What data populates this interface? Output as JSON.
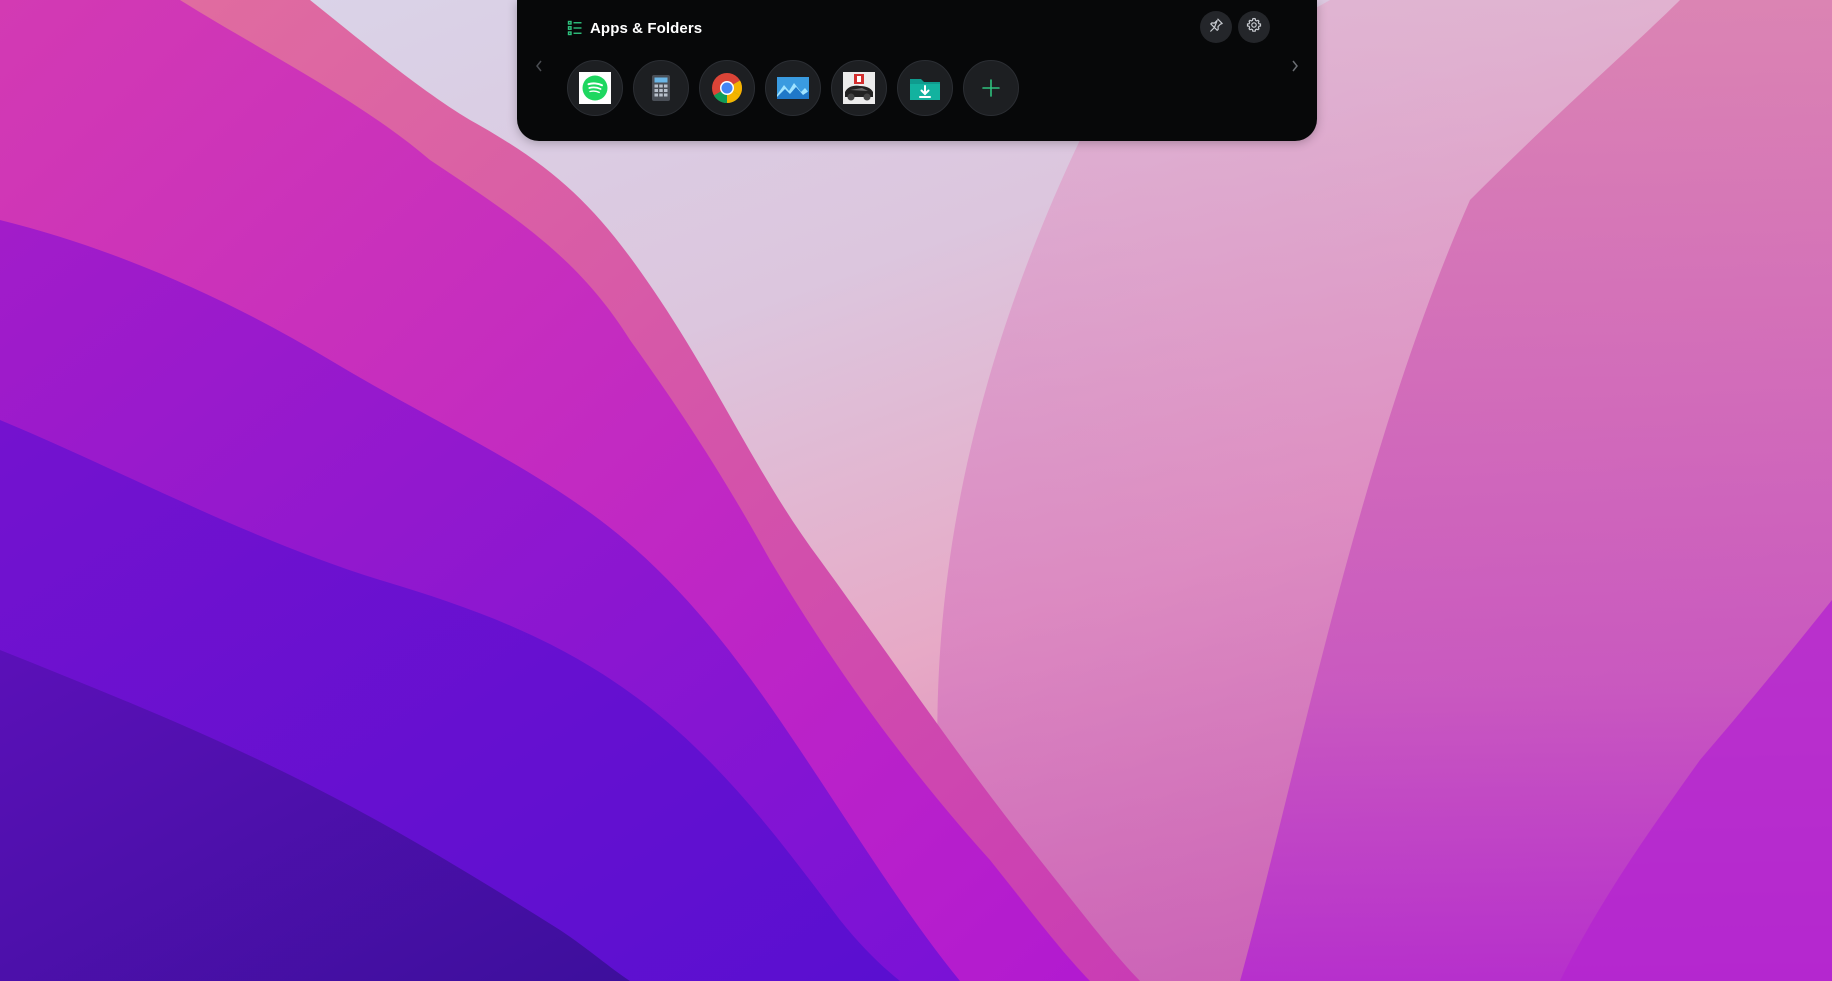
{
  "panel": {
    "title": "Apps & Folders",
    "accent": "#2ec27e"
  },
  "header_actions": [
    {
      "name": "pin-button",
      "icon": "pin-icon"
    },
    {
      "name": "settings-button",
      "icon": "gear-icon"
    }
  ],
  "navigation": {
    "left_icon": "chevron-left-icon",
    "right_icon": "chevron-right-icon"
  },
  "apps": [
    {
      "name": "app-spotify",
      "icon": "spotify-icon"
    },
    {
      "name": "app-calculator",
      "icon": "calculator-icon"
    },
    {
      "name": "app-chrome",
      "icon": "chrome-icon"
    },
    {
      "name": "app-photos",
      "icon": "photos-icon"
    },
    {
      "name": "app-game",
      "icon": "game-icon"
    },
    {
      "name": "folder-downloads",
      "icon": "downloads-folder-icon"
    },
    {
      "name": "add-app",
      "icon": "plus-icon"
    }
  ],
  "colors": {
    "panel_bg": "#070809",
    "button_bg": "#24262a",
    "app_circle_bg": "#1d1f22",
    "spotify_green": "#1ed760",
    "folder_teal": "#0f9b8e"
  }
}
